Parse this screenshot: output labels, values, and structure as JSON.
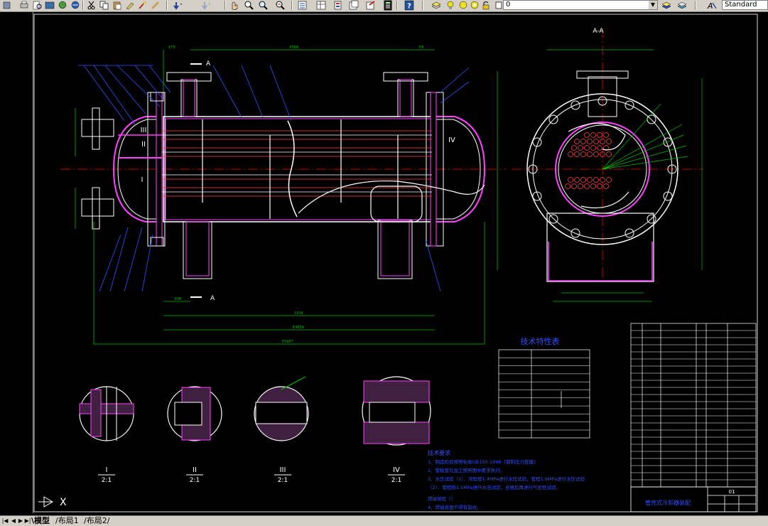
{
  "toolbar": {
    "layer_value": "0",
    "style_value": "Standard"
  },
  "drawing": {
    "section_label": "A-A",
    "cut_mark_top": "A",
    "cut_mark_bottom": "A",
    "zone_labels": [
      "III",
      "II",
      "I",
      "IV"
    ],
    "dim_top_left": "175",
    "dim_top_mid": "P588",
    "dim_top_right": "P8",
    "dim_bottom_1": "508",
    "dim_bottom_2": "1154",
    "dim_bottom_3": "E4654",
    "dim_bottom_4": "E5987",
    "detail_labels": [
      {
        "roman": "I",
        "scale": "2:1"
      },
      {
        "roman": "II",
        "scale": "2:1"
      },
      {
        "roman": "III",
        "scale": "2:1"
      },
      {
        "roman": "IV",
        "scale": "2:1"
      }
    ],
    "tech_table_title": "技术特性表",
    "tech_req_title": "技术要求",
    "tech_req_lines": [
      "1、制造检验按照标准GB150-1998《钢制压力容器》",
      "2、管板管孔加工按照图中要求执行。",
      "3、水压试验（1）、壳程按1.4MPa进行水压试验，管程1.9MPa进行水压试验",
      "         （2）、管程按1.5MPa进行水压试验，合格后再进行气密性试验。",
      "焊接规程（）",
      "4、焊缝表面不得有裂纹。"
    ],
    "title_block_name": "管壳式冷却器装配",
    "title_block_num": "01"
  },
  "tabs": {
    "model": "模型",
    "layout1": "布局1",
    "layout2": "布局2"
  },
  "ucs_label": "X"
}
